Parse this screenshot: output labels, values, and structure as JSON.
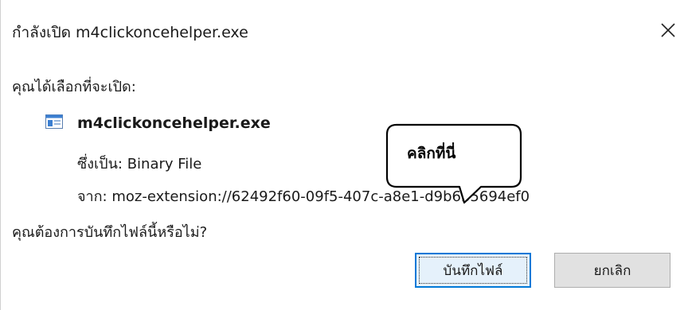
{
  "dialog": {
    "title": "กำลังเปิด m4clickoncehelper.exe",
    "prompt": "คุณได้เลือกที่จะเปิด:",
    "file": {
      "icon": "application-window-icon",
      "name": "m4clickoncehelper.exe",
      "type_label": "ซึ่งเป็น:",
      "type_value": "Binary File",
      "from_label": "จาก:",
      "from_value": "moz-extension://62492f60-09f5-407c-a8e1-d9b6b5694ef0"
    },
    "question": "คุณต้องการบันทึกไฟล์นี้หรือไม่?",
    "buttons": {
      "save": "บันทึกไฟล์",
      "cancel": "ยกเลิก"
    },
    "callout": "คลิกที่นี่",
    "colors": {
      "focus_border": "#0078d7",
      "save_bg": "#e5f1fb",
      "cancel_bg": "#e1e1e1"
    }
  }
}
